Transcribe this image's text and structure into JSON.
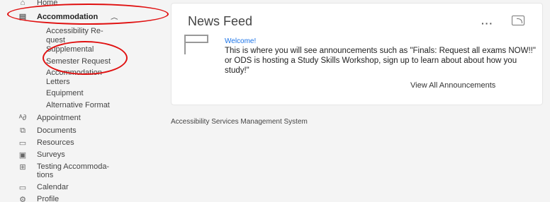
{
  "sidebar": {
    "home": "Home",
    "accommodation": "Accommodation",
    "sub_items": [
      "Accessibility Re-",
      "quest",
      "Supplemental",
      "Semester Request",
      "Accommodation",
      "Letters",
      "Equipment",
      "Alternative Format"
    ],
    "items": [
      {
        "label": "Appointment",
        "icon": "people-icon"
      },
      {
        "label": "Documents",
        "icon": "documents-icon"
      },
      {
        "label": "Resources",
        "icon": "folder-icon"
      },
      {
        "label": "Surveys",
        "icon": "survey-icon"
      },
      {
        "label": "Testing Accommoda-",
        "icon": "testing-icon"
      },
      {
        "label": "tions",
        "icon": ""
      },
      {
        "label": "Calendar",
        "icon": "calendar-icon"
      },
      {
        "label": "Profile",
        "icon": "profile-icon"
      }
    ]
  },
  "news": {
    "title": "News Feed",
    "more": "···",
    "welcome": "Welcome!",
    "message": "This is where you will see announcements such as \"Finals: Request all exams NOW!!\" or ODS is hosting a Study Skills Workshop, sign up to learn about about how you study!\"",
    "view_all": "View All Announcements"
  },
  "footer": "Accessibility Services Management System",
  "colors": {
    "annotation": "#e01010",
    "link": "#1a73e8",
    "background": "#f4f4f4"
  }
}
